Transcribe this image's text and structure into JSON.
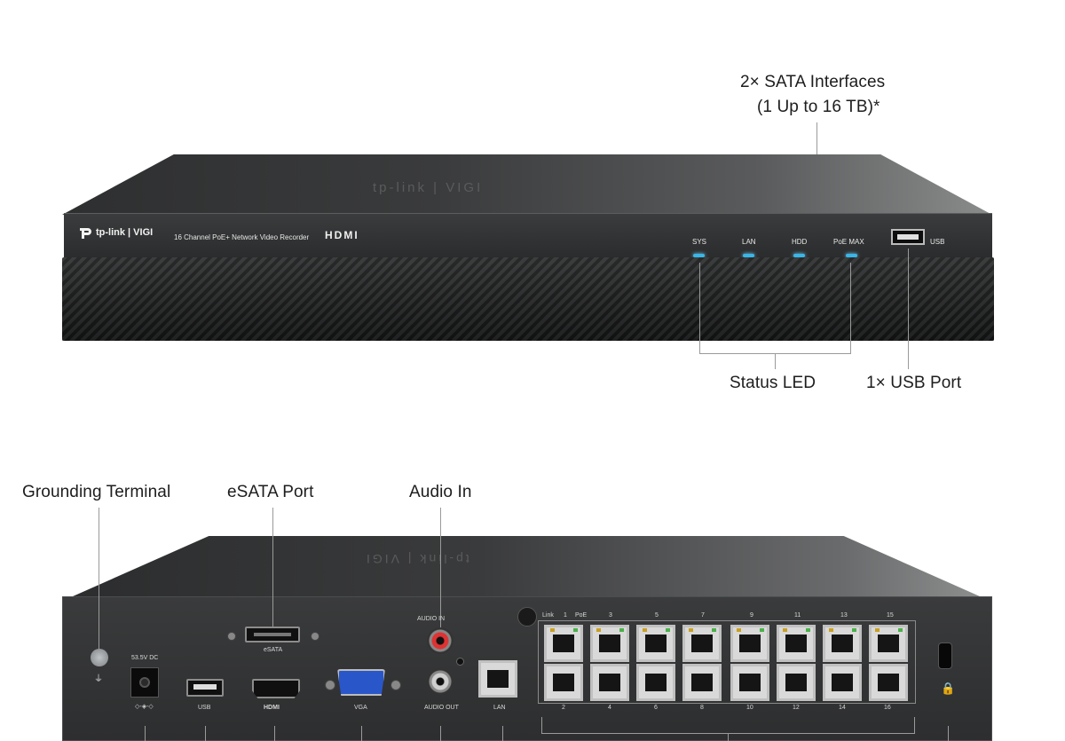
{
  "front": {
    "logo_text": "tp-link | VIGI",
    "model_text": "16 Channel PoE+ Network Video Recorder",
    "hdmi_logo": "HDMI",
    "top_logo": "tp-link | VIGI",
    "led_labels": [
      "SYS",
      "LAN",
      "HDD",
      "PoE MAX"
    ],
    "usb_label": "USB"
  },
  "callouts": {
    "sata_line1": "2× SATA Interfaces",
    "sata_line2": "(1 Up to 16 TB)*",
    "status_led": "Status LED",
    "usb_port": "1× USB Port",
    "grounding_terminal": "Grounding Terminal",
    "esata_port": "eSATA Port",
    "audio_in": "Audio In"
  },
  "rear": {
    "top_logo": "tp-link | VIGI",
    "power_label": "53.5V DC",
    "usb_label": "USB",
    "hdmi_label": "HDMI",
    "vga_label": "VGA",
    "esata_label": "eSATA",
    "audio_in_label": "AUDIO IN",
    "audio_out_label": "AUDIO OUT",
    "lan_label": "LAN",
    "port_header": [
      "Link",
      "1",
      "PoE",
      "3",
      "5",
      "7",
      "9",
      "11",
      "13",
      "15"
    ],
    "port_footer": [
      "2",
      "4",
      "6",
      "8",
      "10",
      "12",
      "14",
      "16"
    ]
  },
  "colors": {
    "led": "#3ab6e6",
    "chassis": "#2e2f30",
    "audio_in_ring": "#d33"
  }
}
